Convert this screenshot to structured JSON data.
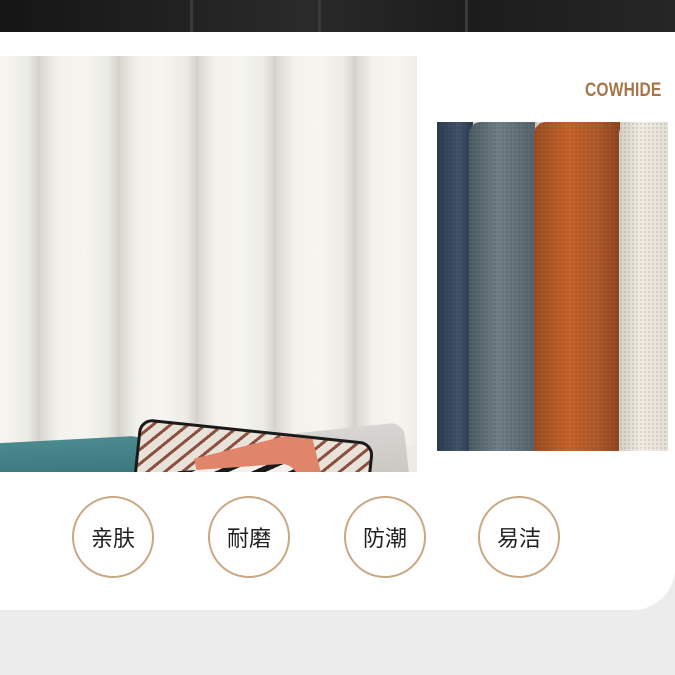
{
  "brand": {
    "material_label": "COWHIDE",
    "accent_color": "#a67649",
    "circle_border_color": "#c9a883"
  },
  "swatch_colors": [
    "#33445a",
    "#65737b",
    "#c0602a",
    "#ece8df"
  ],
  "features": [
    {
      "label": "亲肤"
    },
    {
      "label": "耐磨"
    },
    {
      "label": "防潮"
    },
    {
      "label": "易洁"
    }
  ]
}
